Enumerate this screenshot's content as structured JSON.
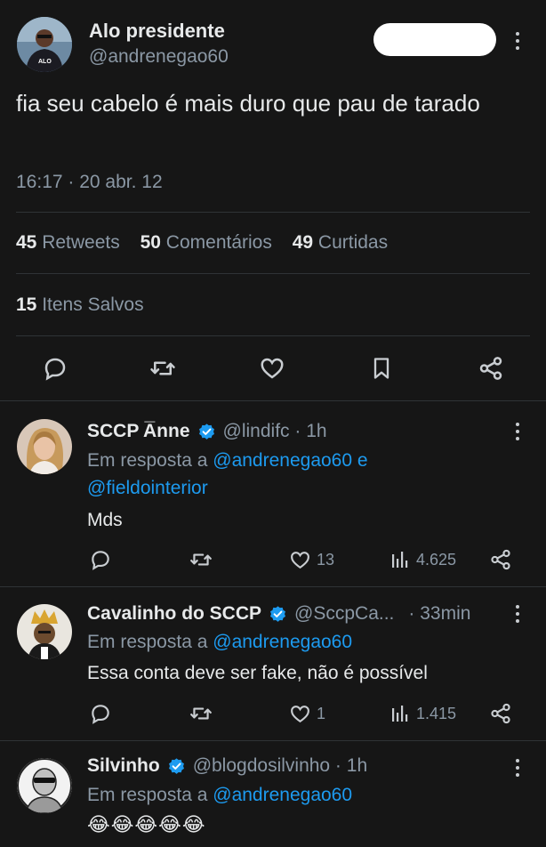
{
  "main_post": {
    "author_name": "Alo presidente",
    "author_handle": "@andrenegao60",
    "avatar_icon": "person-avatar",
    "text": "fia seu cabelo é mais duro que pau de tarado",
    "timestamp": "16:17 · 20 abr. 12",
    "stats": {
      "retweets_count": "45",
      "retweets_label": "Retweets",
      "comments_count": "50",
      "comments_label": "Comentários",
      "likes_count": "49",
      "likes_label": "Curtidas",
      "saved_count": "15",
      "saved_label": "Itens Salvos"
    },
    "actions": [
      "reply-icon",
      "retweet-icon",
      "like-icon",
      "bookmark-icon",
      "share-icon"
    ]
  },
  "replies": [
    {
      "name": "SCCP A̅nne",
      "handle": "@lindifc · 1h",
      "reply_prefix": "Em resposta a",
      "reply_to_1": "@andrenegao60",
      "reply_join": "e",
      "reply_to_2": "@fieldointerior",
      "text": "Mds",
      "likes": "13",
      "views": "4.625"
    },
    {
      "name": "Cavalinho do SCCP",
      "handle": "@SccpCa...",
      "time": "· 33min",
      "reply_prefix": "Em resposta a",
      "reply_to_1": "@andrenegao60",
      "text": "Essa conta deve ser fake, não é possível",
      "likes": "1",
      "views": "1.415"
    },
    {
      "name": "Silvinho",
      "handle": "@blogdosilvinho · 1h",
      "reply_prefix": "Em resposta a",
      "reply_to_1": "@andrenegao60",
      "text": "😂😂😂😂😂"
    }
  ],
  "colors": {
    "background": "#161616",
    "link": "#1d9bf0",
    "muted": "#8b98a5",
    "text": "#e7e9ea"
  }
}
